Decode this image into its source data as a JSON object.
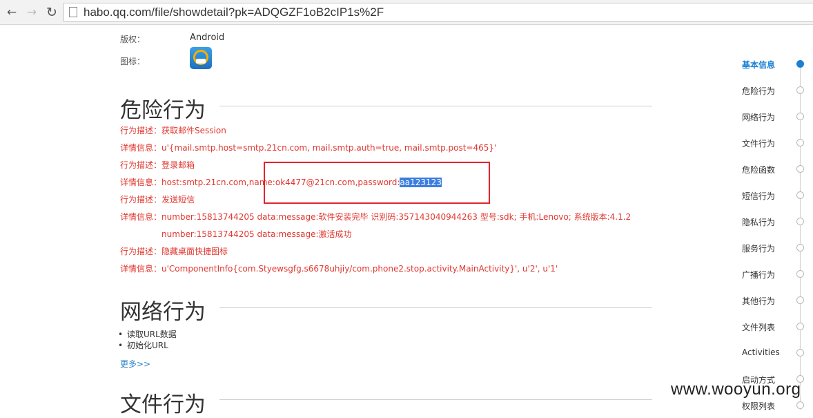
{
  "browser": {
    "url": "habo.qq.com/file/showdetail?pk=ADQGZF1oB2cIP1s%2F"
  },
  "app_info": {
    "copyright_label": "版权：",
    "copyright_value": "Android",
    "icon_label": "图标："
  },
  "sections": {
    "risk_title": "危险行为",
    "network_title": "网络行为",
    "file_title": "文件行为"
  },
  "risk_items": [
    {
      "label": "行为描述：",
      "value": "获取邮件Session"
    },
    {
      "label": "详情信息：",
      "value": "u'{mail.smtp.host=smtp.21cn.com, mail.smtp.auth=true, mail.smtp.post=465}'"
    },
    {
      "label": "行为描述：",
      "value": "登录邮箱"
    },
    {
      "label": "详情信息：",
      "value": "host:smtp.21cn.com,name:ok4477@21cn.com,password:",
      "highlight": "aa123123"
    },
    {
      "label": "行为描述：",
      "value": "发送短信"
    },
    {
      "label": "详情信息：",
      "value": "number:15813744205 data:message:软件安装完毕 识别码:357143040944263 型号:sdk; 手机:Lenovo; 系统版本:4.1.2"
    },
    {
      "continuation": "number:15813744205 data:message:激活成功"
    },
    {
      "label": "行为描述：",
      "value": "隐藏桌面快捷图标"
    },
    {
      "label": "详情信息：",
      "value": "u'ComponentInfo{com.Styewsgfg.s6678uhjiy/com.phone2.stop.activity.MainActivity}', u'2', u'1'"
    }
  ],
  "network_items": [
    "读取URL数据",
    "初始化URL"
  ],
  "more_link": "更多>>",
  "right_nav": {
    "items": [
      "基本信息",
      "危险行为",
      "网络行为",
      "文件行为",
      "危险函数",
      "短信行为",
      "隐私行为",
      "服务行为",
      "广播行为",
      "其他行为",
      "文件列表",
      "Activities",
      "启动方式",
      "权限列表"
    ],
    "active_index": 0
  },
  "watermark": "www.wooyun.org",
  "colors": {
    "accent": "#1a7fd5",
    "risk_text": "#e0372f",
    "highlight": "#3b7ddd",
    "box": "#e2242c"
  }
}
